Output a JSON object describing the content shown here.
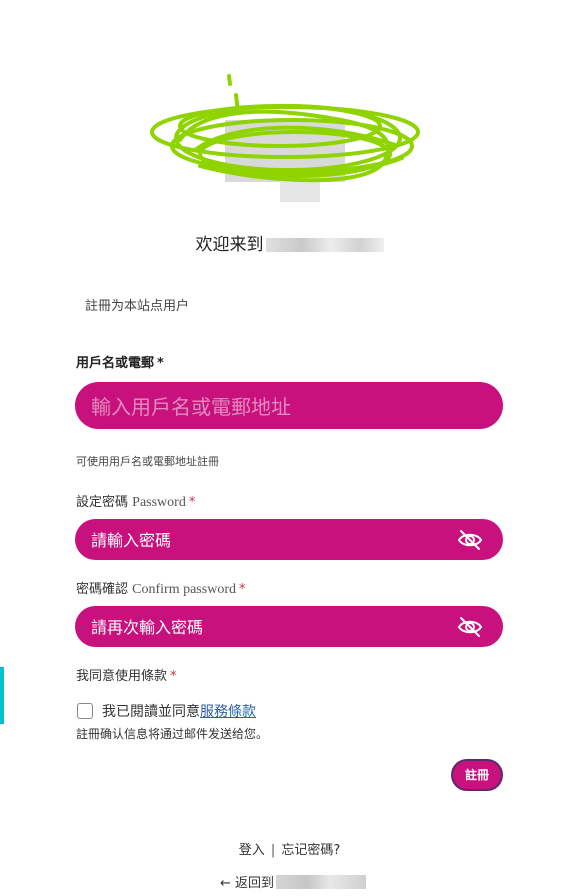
{
  "header": {
    "welcome_text": "欢迎来到",
    "subtitle": "註冊为本站点用户"
  },
  "form": {
    "username": {
      "label": "用戶名或電郵",
      "required_mark": "*",
      "placeholder": "輸入用戶名或電郵地址",
      "hint": "可使用用戶名或電郵地址註冊"
    },
    "password": {
      "label": "設定密碼",
      "label_en": "Password",
      "required_mark": "*",
      "placeholder": "請輸入密碼",
      "toggle_icon": "eye-slash-icon"
    },
    "confirm_password": {
      "label": "密碼確認",
      "label_en": "Confirm password",
      "required_mark": "*",
      "placeholder": "請再次輸入密碼",
      "toggle_icon": "eye-slash-icon"
    },
    "terms": {
      "label": "我同意使用條款",
      "required_mark": "*",
      "checkbox_text": "我已閱讀並同意",
      "link_text": "服務條款",
      "checked": false
    },
    "confirmation_note": "註冊确认信息将通过邮件发送给您。",
    "submit_label": "註冊"
  },
  "footer": {
    "login_link": "登入",
    "separator": "|",
    "forgot_link": "忘记密碼?",
    "back_link": "← 返回到"
  },
  "colors": {
    "accent": "#c8117d",
    "logo_scribble": "#8fd400",
    "required": "#c62d48",
    "link": "#2d5fa8"
  }
}
